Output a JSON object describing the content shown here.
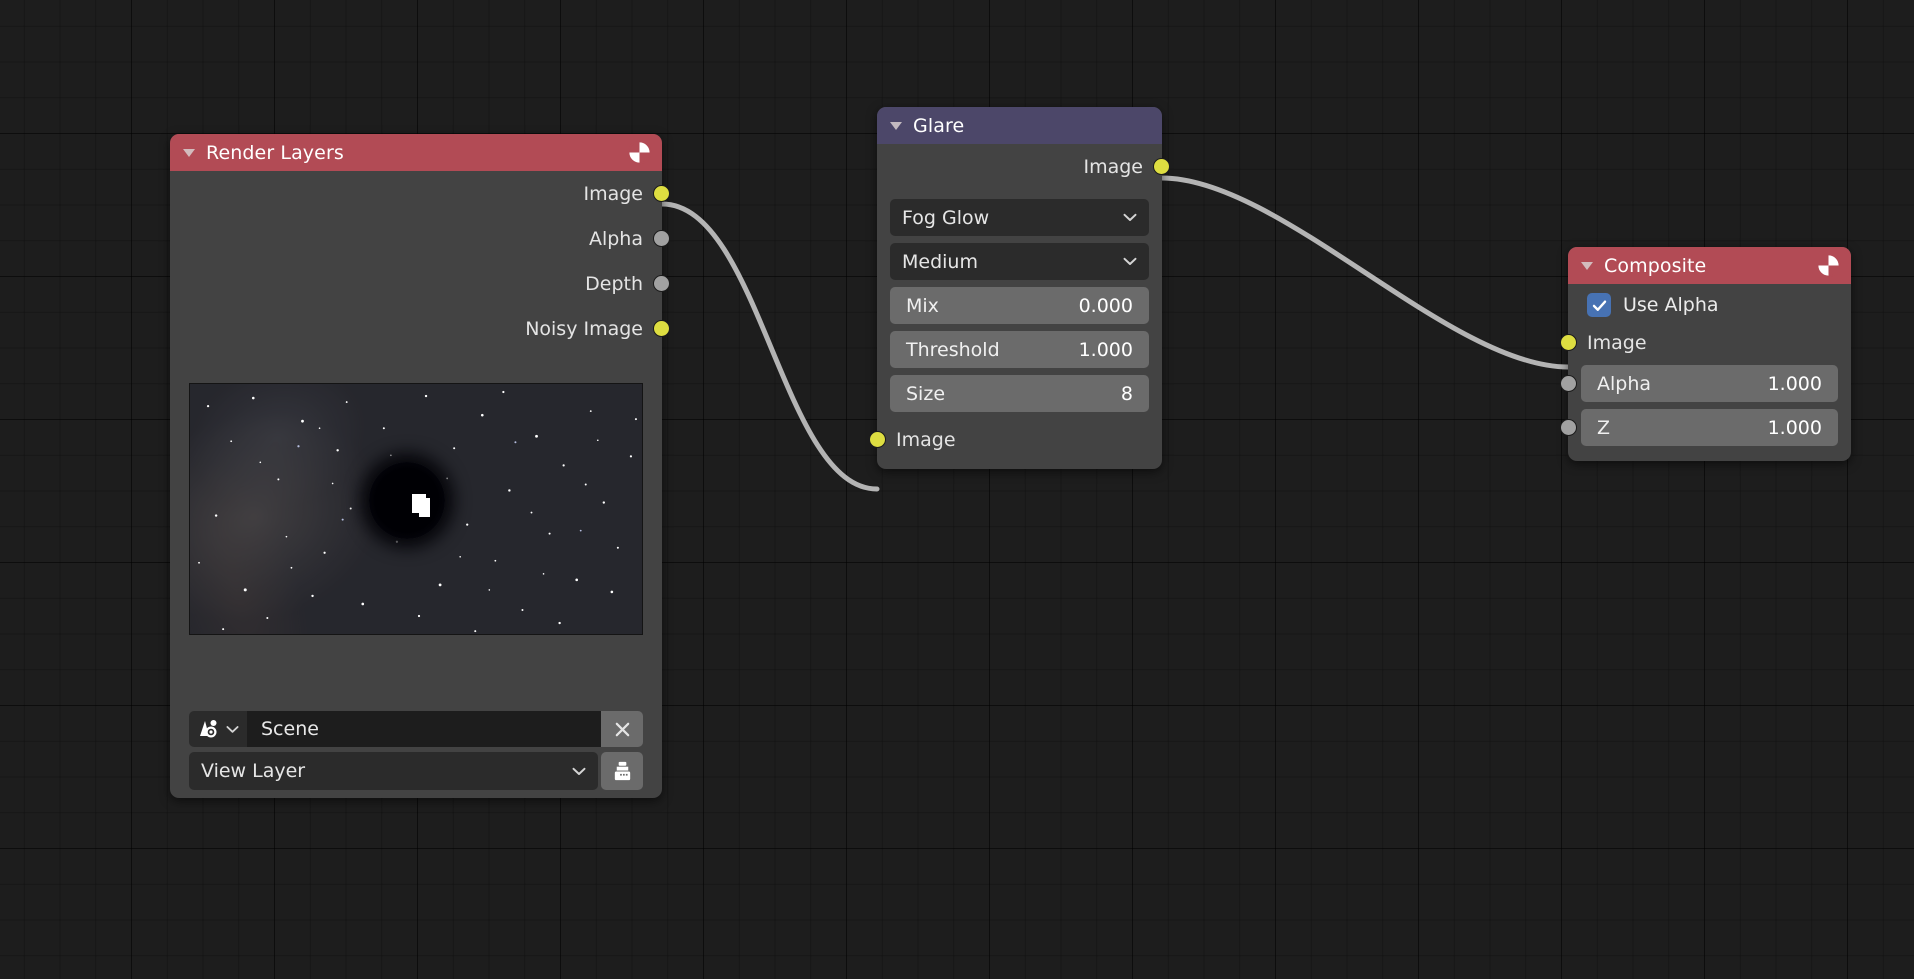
{
  "editor": {
    "name": "Blender Compositor Node Editor",
    "background_color": "#1d1d1d",
    "grid_color": "#181818"
  },
  "colors": {
    "node_body": "#434343",
    "header_output": "#b24b55",
    "header_filter": "#4c4769",
    "socket_image": "#dede41",
    "socket_value": "#a1a1a1",
    "link": "#b4b4b4",
    "checkbox_on": "#4772b3",
    "field_bg": "#6b6b6b",
    "dropdown_bg": "#2b2b2b"
  },
  "nodes": {
    "render_layers": {
      "title": "Render Layers",
      "header_icon": "render-result-icon",
      "collapse_icon": "collapse-triangle-icon",
      "outputs": [
        {
          "label": "Image",
          "type": "image"
        },
        {
          "label": "Alpha",
          "type": "value"
        },
        {
          "label": "Depth",
          "type": "value"
        },
        {
          "label": "Noisy Image",
          "type": "image"
        }
      ],
      "preview": {
        "name": "render-preview-thumbnail",
        "description": "Starfield with Milky Way band and dark sphere"
      },
      "scene_field": {
        "icon": "scene-data-icon",
        "value": "Scene",
        "clear_icon": "close-x-icon"
      },
      "view_layer_field": {
        "value": "View Layer",
        "dropdown_icon": "chevron-down-icon",
        "button_icon": "render-layer-icon"
      }
    },
    "glare": {
      "title": "Glare",
      "collapse_icon": "collapse-triangle-icon",
      "outputs": [
        {
          "label": "Image",
          "type": "image"
        }
      ],
      "dropdowns": [
        {
          "name": "glare-type",
          "value": "Fog Glow",
          "icon": "chevron-down-icon"
        },
        {
          "name": "glare-quality",
          "value": "Medium",
          "icon": "chevron-down-icon"
        }
      ],
      "fields": [
        {
          "label": "Mix",
          "value": "0.000"
        },
        {
          "label": "Threshold",
          "value": "1.000"
        },
        {
          "label": "Size",
          "value": "8"
        }
      ],
      "inputs": [
        {
          "label": "Image",
          "type": "image"
        }
      ]
    },
    "composite": {
      "title": "Composite",
      "header_icon": "render-result-icon",
      "collapse_icon": "collapse-triangle-icon",
      "use_alpha": {
        "label": "Use Alpha",
        "checked": true,
        "icon": "checkmark-icon"
      },
      "inputs": [
        {
          "label": "Image",
          "type": "image",
          "widget": "none",
          "value": ""
        },
        {
          "label": "Alpha",
          "type": "value",
          "widget": "number",
          "value": "1.000"
        },
        {
          "label": "Z",
          "type": "value",
          "widget": "number",
          "value": "1.000"
        }
      ]
    }
  },
  "links": [
    {
      "from": "render_layers.Image",
      "to": "glare.Image"
    },
    {
      "from": "glare.Image",
      "to": "composite.Image"
    }
  ]
}
